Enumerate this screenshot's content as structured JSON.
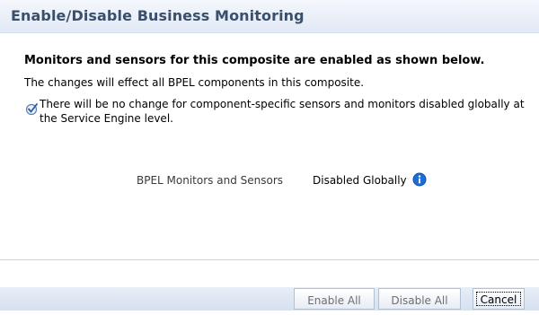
{
  "dialog": {
    "title": "Enable/Disable Business Monitoring",
    "headline": "Monitors and sensors for this composite are enabled as shown below.",
    "effect_text": "The changes will effect all BPEL components in this composite.",
    "note_icon": "checkmark-circle-icon",
    "note_text": "There will be no change for component-specific sensors and monitors disabled globally at the Service Engine level."
  },
  "status": {
    "label": "BPEL Monitors and Sensors",
    "value": "Disabled Globally",
    "info_icon": "info-icon"
  },
  "buttons": {
    "enable_all": "Enable All",
    "disable_all": "Disable All",
    "cancel": "Cancel"
  },
  "colors": {
    "title_text": "#3a4f6b",
    "titlebar_bg": "#e1e9f5",
    "footer_bg": "#d6e0ef",
    "info_blue": "#1d6fd4"
  }
}
